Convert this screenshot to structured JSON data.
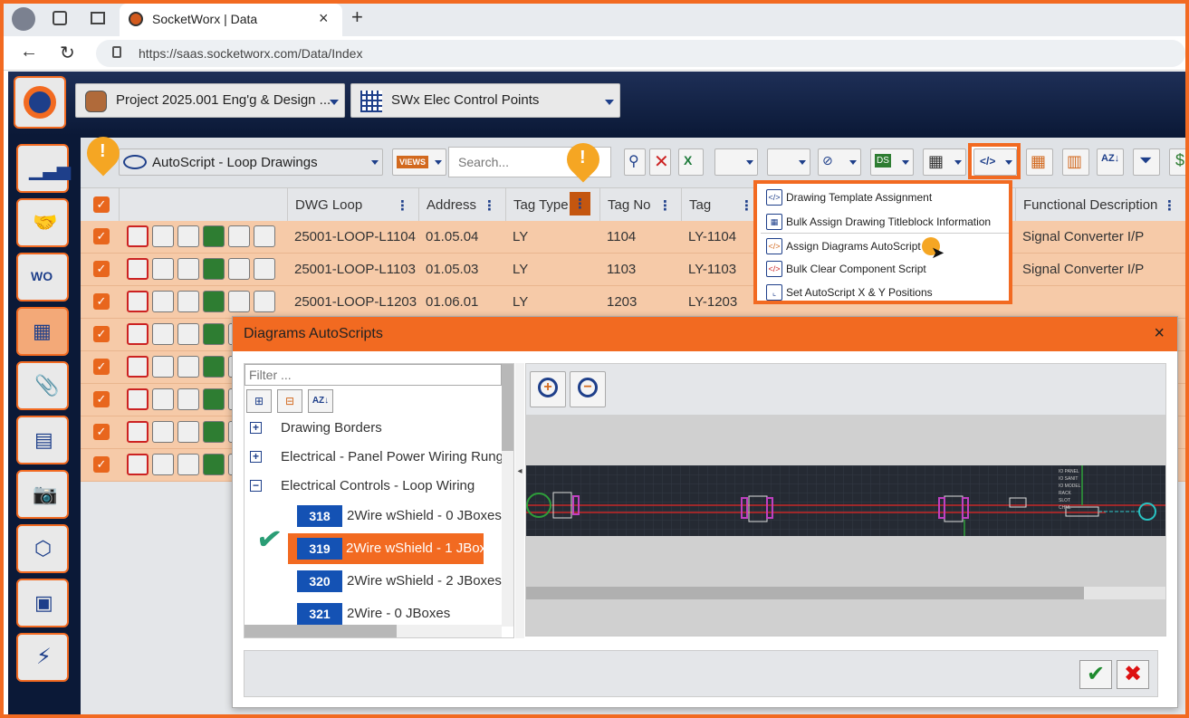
{
  "browser": {
    "tab_title": "SocketWorx | Data",
    "url": "https://saas.socketworx.com/Data/Index"
  },
  "header": {
    "project": "Project 2025.001 Eng'g & Design ...",
    "table": "SWx Elec Control Points"
  },
  "toolbar": {
    "view": "AutoScript - Loop Drawings",
    "views_label": "VIEWS",
    "search_placeholder": "Search..."
  },
  "columns": [
    "DWG Loop",
    "Address",
    "Tag Type",
    "Tag No",
    "Tag",
    "Functional Description"
  ],
  "rows": [
    {
      "loop": "25001-LOOP-L1104",
      "address": "01.05.04",
      "tag_type": "LY",
      "tag_no": "1104",
      "tag": "LY-1104",
      "desc": "Signal Converter I/P"
    },
    {
      "loop": "25001-LOOP-L1103",
      "address": "01.05.03",
      "tag_type": "LY",
      "tag_no": "1103",
      "tag": "LY-1103",
      "desc": "Signal Converter I/P"
    },
    {
      "loop": "25001-LOOP-L1203",
      "address": "01.06.01",
      "tag_type": "LY",
      "tag_no": "1203",
      "tag": "LY-1203",
      "desc": ""
    }
  ],
  "menu": [
    "Drawing Template Assignment",
    "Bulk Assign Drawing Titleblock Information",
    "Assign Diagrams AutoScript",
    "Bulk Clear Component Script",
    "Set AutoScript X & Y Positions"
  ],
  "modal": {
    "title": "Diagrams AutoScripts",
    "close": "×",
    "filter_placeholder": "Filter ...",
    "groups": [
      {
        "label": "Drawing Borders",
        "state": "+"
      },
      {
        "label": "Electrical - Panel Power Wiring Rungs",
        "state": "+"
      },
      {
        "label": "Electrical Controls - Loop Wiring",
        "state": "−"
      }
    ],
    "items": [
      {
        "num": "318",
        "label": "2Wire wShield - 0 JBoxes"
      },
      {
        "num": "319",
        "label": "2Wire wShield - 1 JBox"
      },
      {
        "num": "320",
        "label": "2Wire wShield - 2 JBoxes"
      },
      {
        "num": "321",
        "label": "2Wire - 0 JBoxes"
      }
    ],
    "preview_labels": [
      "IO PANEL",
      "IO SANIT",
      "IO MODEL",
      "RACK",
      "SLOT",
      "CHNL"
    ]
  },
  "colors": {
    "accent": "#f26a21",
    "nav": "#0b1937",
    "row": "#f6caa8",
    "blue": "#1452b4"
  }
}
